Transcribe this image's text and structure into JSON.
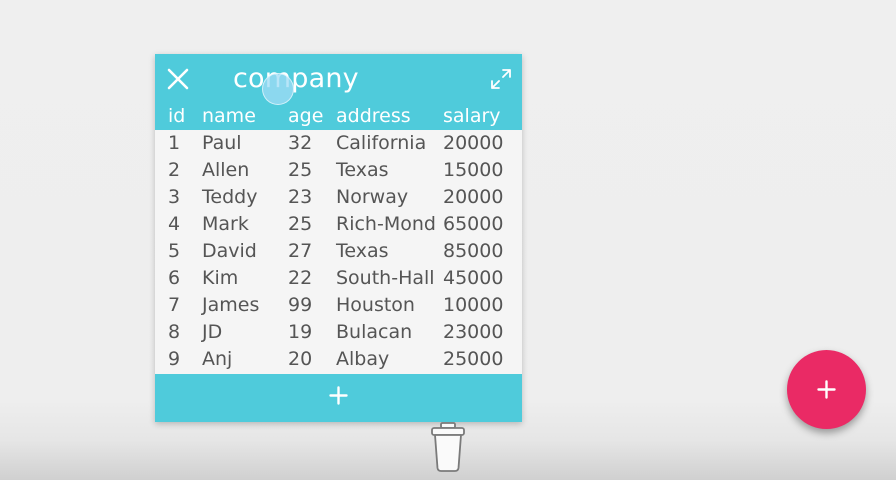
{
  "table_card": {
    "title": "company",
    "columns": [
      "id",
      "name",
      "age",
      "address",
      "salary"
    ],
    "rows": [
      {
        "id": "1",
        "name": "Paul",
        "age": "32",
        "address": "California",
        "salary": "20000"
      },
      {
        "id": "2",
        "name": "Allen",
        "age": "25",
        "address": "Texas",
        "salary": "15000"
      },
      {
        "id": "3",
        "name": "Teddy",
        "age": "23",
        "address": "Norway",
        "salary": "20000"
      },
      {
        "id": "4",
        "name": "Mark",
        "age": "25",
        "address": "Rich-Mond",
        "salary": "65000"
      },
      {
        "id": "5",
        "name": "David",
        "age": "27",
        "address": "Texas",
        "salary": "85000"
      },
      {
        "id": "6",
        "name": "Kim",
        "age": "22",
        "address": "South-Hall",
        "salary": "45000"
      },
      {
        "id": "7",
        "name": "James",
        "age": "99",
        "address": "Houston",
        "salary": "10000"
      },
      {
        "id": "8",
        "name": "JD",
        "age": "19",
        "address": "Bulacan",
        "salary": "23000"
      },
      {
        "id": "9",
        "name": "Anj",
        "age": "20",
        "address": "Albay",
        "salary": "25000"
      }
    ],
    "icons": {
      "close": "close-icon",
      "expand": "expand-icon",
      "add_row": "plus-icon"
    }
  },
  "trash": {
    "icon": "trash-icon"
  },
  "fab": {
    "icon": "plus-icon"
  },
  "colors": {
    "card_accent": "#4fcbdb",
    "fab": "#ea2a65",
    "row_text": "#555555",
    "card_body": "#f5f5f5"
  }
}
